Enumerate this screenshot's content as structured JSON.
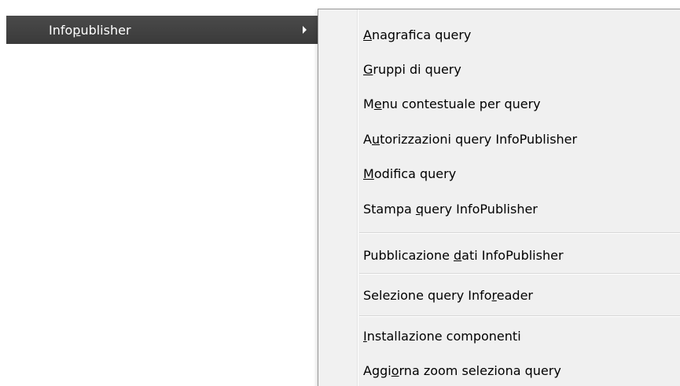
{
  "parent_menu": {
    "label_before": "Info",
    "label_mnemonic": "p",
    "label_after": "ublisher"
  },
  "submenu": {
    "items": [
      {
        "before": "",
        "mnemonic": "A",
        "after": "nagrafica query"
      },
      {
        "before": "",
        "mnemonic": "G",
        "after": "ruppi di query"
      },
      {
        "before": "M",
        "mnemonic": "e",
        "after": "nu contestuale per query"
      },
      {
        "before": "A",
        "mnemonic": "u",
        "after": "torizzazioni query InfoPublisher"
      },
      {
        "before": "",
        "mnemonic": "M",
        "after": "odifica query"
      },
      {
        "before": "Stampa ",
        "mnemonic": "q",
        "after": "uery InfoPublisher"
      },
      {
        "before": "Pubblicazione ",
        "mnemonic": "d",
        "after": "ati InfoPublisher"
      },
      {
        "before": "Selezione query Info",
        "mnemonic": "r",
        "after": "eader"
      },
      {
        "before": "",
        "mnemonic": "I",
        "after": "nstallazione componenti"
      },
      {
        "before": "Aggi",
        "mnemonic": "o",
        "after": "rna zoom seleziona query"
      }
    ]
  },
  "colors": {
    "highlight_bg": "#404040",
    "menu_bg": "#f0f0f0",
    "separator": "#d7d7d7"
  }
}
